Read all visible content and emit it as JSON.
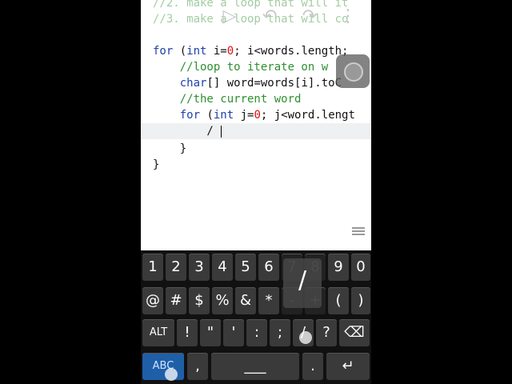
{
  "editor": {
    "lines": [
      {
        "parts": [
          {
            "t": "//2. make a loop that will it",
            "c": "cm"
          }
        ]
      },
      {
        "parts": [
          {
            "t": "//3. make a loop that will co",
            "c": "cm"
          }
        ]
      },
      {
        "parts": [
          {
            "t": "for",
            "c": "kw"
          },
          {
            "t": " (",
            "c": "tx"
          },
          {
            "t": "int",
            "c": "kw"
          },
          {
            "t": " i=",
            "c": "tx"
          },
          {
            "t": "0",
            "c": "num"
          },
          {
            "t": "; i<words.length;",
            "c": "tx"
          }
        ]
      },
      {
        "parts": [
          {
            "t": "    //loop to iterate on w",
            "c": "cm"
          }
        ]
      },
      {
        "parts": [
          {
            "t": "    char",
            "c": "kw"
          },
          {
            "t": "[] word=words[i].toC",
            "c": "tx"
          }
        ]
      },
      {
        "parts": [
          {
            "t": "    //the current word",
            "c": "cm"
          }
        ]
      },
      {
        "parts": [
          {
            "t": "    for",
            "c": "kw"
          },
          {
            "t": " (",
            "c": "tx"
          },
          {
            "t": "int",
            "c": "kw"
          },
          {
            "t": " j=",
            "c": "tx"
          },
          {
            "t": "0",
            "c": "num"
          },
          {
            "t": "; j<word.lengt",
            "c": "tx"
          }
        ]
      },
      {
        "parts": [
          {
            "t": "        /",
            "c": "tx"
          }
        ]
      },
      {
        "parts": [
          {
            "t": "    }",
            "c": "tx"
          }
        ]
      },
      {
        "parts": [
          {
            "t": "}",
            "c": "tx"
          }
        ]
      }
    ]
  },
  "toolbar": {
    "icons": [
      "play-icon",
      "undo-icon",
      "redo-icon",
      "more-icon"
    ]
  },
  "keyboard": {
    "rows": [
      [
        "1",
        "2",
        "3",
        "4",
        "5",
        "6",
        "7",
        "8",
        "9",
        "0"
      ],
      [
        "@",
        "#",
        "$",
        "%",
        "&",
        "*",
        "-",
        "+",
        "(",
        ")"
      ],
      [
        "ALT",
        "!",
        "\"",
        "'",
        ":",
        ";",
        "/",
        "?",
        "⌫"
      ],
      [
        "ABC",
        ",",
        "___",
        ".",
        "↵"
      ]
    ],
    "popup_char": "/"
  }
}
